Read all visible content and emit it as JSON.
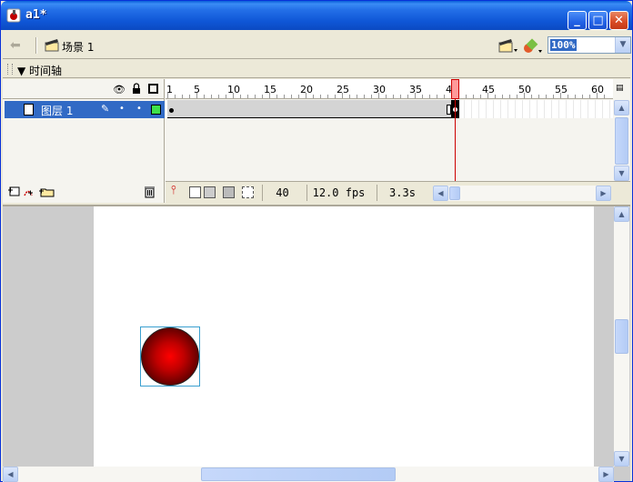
{
  "window": {
    "title": "a1*"
  },
  "toolbar": {
    "scene_label": "场景 1",
    "zoom": "100%"
  },
  "timeline": {
    "title": "时间轴",
    "ruler_numbers": [
      "1",
      "5",
      "10",
      "15",
      "20",
      "25",
      "30",
      "35",
      "40",
      "45",
      "50",
      "55",
      "60"
    ],
    "layer": {
      "name": "图层 1",
      "color": "#3ee04a"
    },
    "current_frame": "40",
    "fps": "12.0 fps",
    "elapsed": "3.3s"
  },
  "stage": {
    "shape_colors": {
      "center": "#ff0000",
      "edge": "#1a0000"
    }
  }
}
